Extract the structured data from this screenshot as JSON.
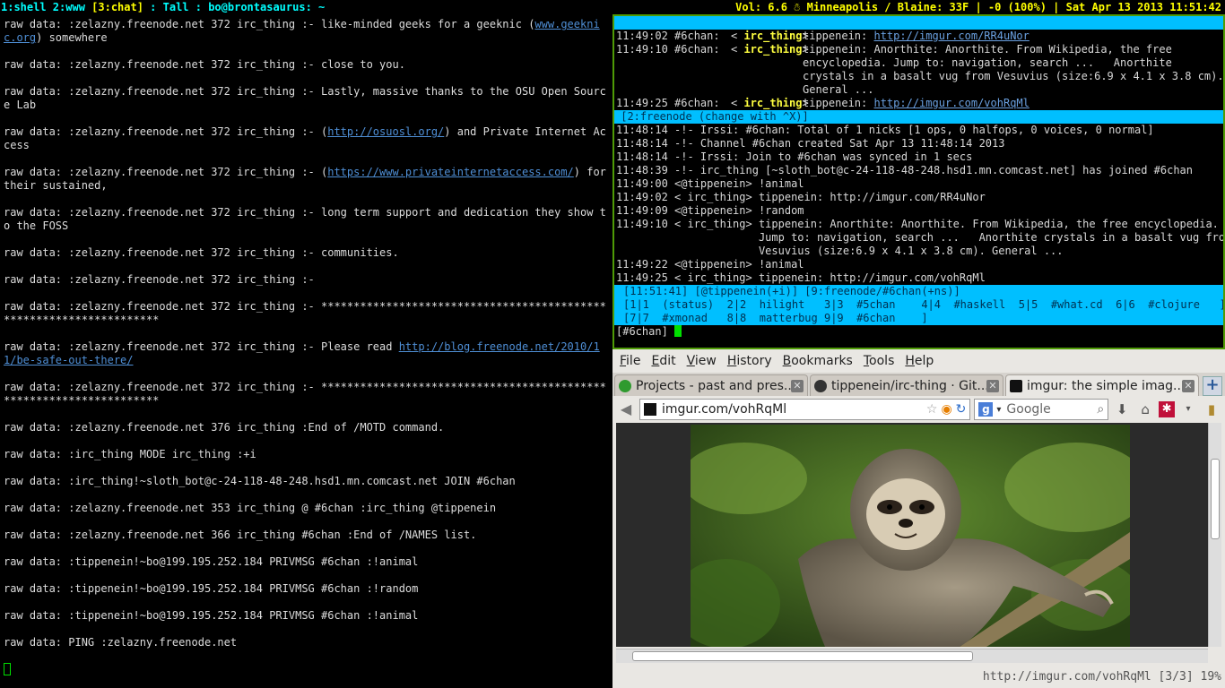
{
  "topbar": {
    "workspaces_before": "1:shell 2:www ",
    "active_workspace": "[3:chat]",
    "workspaces_after": " : Tall : bo@brontasaurus: ~",
    "status_right": "Vol: 6.6 ☃ Minneapolis / Blaine: 33F | -0 (100%) | Sat Apr 13 2013 11:51:42"
  },
  "rawlog": [
    {
      "text": "raw data: :zelazny.freenode.net 372 irc_thing :- like-minded geeks for a geeknic (",
      "link": "www.geeknic.org",
      "after": ") somewhere"
    },
    {
      "text": "raw data: :zelazny.freenode.net 372 irc_thing :- close to you."
    },
    {
      "text": "raw data: :zelazny.freenode.net 372 irc_thing :- Lastly, massive thanks to the OSU Open Source Lab"
    },
    {
      "text": "raw data: :zelazny.freenode.net 372 irc_thing :- (",
      "link": "http://osuosl.org/",
      "after": ") and Private Internet Access"
    },
    {
      "text": "raw data: :zelazny.freenode.net 372 irc_thing :- (",
      "link": "https://www.privateinternetaccess.com/",
      "after": ") for their sustained,"
    },
    {
      "text": "raw data: :zelazny.freenode.net 372 irc_thing :- long term support and dedication they show to the FOSS"
    },
    {
      "text": "raw data: :zelazny.freenode.net 372 irc_thing :- communities."
    },
    {
      "text": "raw data: :zelazny.freenode.net 372 irc_thing :-"
    },
    {
      "text": "raw data: :zelazny.freenode.net 372 irc_thing :- ********************************************************************"
    },
    {
      "text": "raw data: :zelazny.freenode.net 372 irc_thing :- Please read ",
      "link": "http://blog.freenode.net/2010/11/be-safe-out-there/",
      "after": ""
    },
    {
      "text": "raw data: :zelazny.freenode.net 372 irc_thing :- ********************************************************************"
    },
    {
      "text": "raw data: :zelazny.freenode.net 376 irc_thing :End of /MOTD command."
    },
    {
      "text": "raw data: :irc_thing MODE irc_thing :+i"
    },
    {
      "text": "raw data: :irc_thing!~sloth_bot@c-24-118-48-248.hsd1.mn.comcast.net JOIN #6chan"
    },
    {
      "text": "raw data: :zelazny.freenode.net 353 irc_thing @ #6chan :irc_thing @tippenein"
    },
    {
      "text": "raw data: :zelazny.freenode.net 366 irc_thing #6chan :End of /NAMES list."
    },
    {
      "text": "raw data: :tippenein!~bo@199.195.252.184 PRIVMSG #6chan :!animal"
    },
    {
      "text": "raw data: :tippenein!~bo@199.195.252.184 PRIVMSG #6chan :!random"
    },
    {
      "text": "raw data: :tippenein!~bo@199.195.252.184 PRIVMSG #6chan :!animal"
    },
    {
      "text": "raw data: PING :zelazny.freenode.net"
    }
  ],
  "irssi": {
    "split_top": [
      {
        "ts": "11:49:02 #6chan:",
        "nick": "irc_thing",
        "msg": "tippenein: ",
        "link": "http://imgur.com/RR4uNor"
      },
      {
        "ts": "11:49:10 #6chan:",
        "nick": "irc_thing",
        "msg": "tippenein: Anorthite: Anorthite. From Wikipedia, the free"
      },
      {
        "ts": "",
        "nick": "",
        "msg": "encyclopedia. Jump to: navigation, search ...   Anorthite"
      },
      {
        "ts": "",
        "nick": "",
        "msg": "crystals in a basalt vug from Vesuvius (size:6.9 x 4.1 x 3.8 cm)."
      },
      {
        "ts": "",
        "nick": "",
        "msg": "General ..."
      },
      {
        "ts": "11:49:25 #6chan:",
        "nick": "irc_thing",
        "msg": "tippenein: ",
        "link": "http://imgur.com/vohRqMl"
      }
    ],
    "split_bar": " [2:freenode (change with ^X)]",
    "lines": [
      "11:48:14 -!- Irssi: #6chan: Total of 1 nicks [1 ops, 0 halfops, 0 voices, 0 normal]",
      "11:48:14 -!- Channel #6chan created Sat Apr 13 11:48:14 2013",
      "11:48:14 -!- Irssi: Join to #6chan was synced in 1 secs",
      "11:48:39 -!- irc_thing [~sloth_bot@c-24-118-48-248.hsd1.mn.comcast.net] has joined #6chan",
      "11:49:00 <@tippenein> !animal",
      "11:49:02 < irc_thing> tippenein: http://imgur.com/RR4uNor",
      "11:49:09 <@tippenein> !random",
      "11:49:10 < irc_thing> tippenein: Anorthite: Anorthite. From Wikipedia, the free encyclopedia.",
      "                      Jump to: navigation, search ...   Anorthite crystals in a basalt vug from",
      "                      Vesuvius (size:6.9 x 4.1 x 3.8 cm). General ...",
      "11:49:22 <@tippenein> !animal",
      "11:49:25 < irc_thing> tippenein: http://imgur.com/vohRqMl"
    ],
    "status_line": "[11:51:41] [@tippenein(+i)] [9:freenode/#6chan(+ns)]",
    "act_line1": "[1|1  (status)  2|2  hilight   3|3  #5chan    4|4  #haskell  5|5  #what.cd  6|6  #clojure   ]",
    "act_line2": "[7|7  #xmonad   8|8  matterbug 9|9  #6chan    ]",
    "prompt": "[#6chan] "
  },
  "firefox": {
    "menu": [
      "File",
      "Edit",
      "View",
      "History",
      "Bookmarks",
      "Tools",
      "Help"
    ],
    "tabs": [
      {
        "label": "Projects - past and pres...",
        "icon_color": "#2f9a2f"
      },
      {
        "label": "tippenein/irc-thing · Git...",
        "icon_color": "#333333"
      },
      {
        "label": "imgur: the simple imag...",
        "icon_color": "#111111"
      }
    ],
    "url": "imgur.com/vohRqMl",
    "search_engine": "Google",
    "status": "http://imgur.com/vohRqMl [3/3] 19%"
  }
}
